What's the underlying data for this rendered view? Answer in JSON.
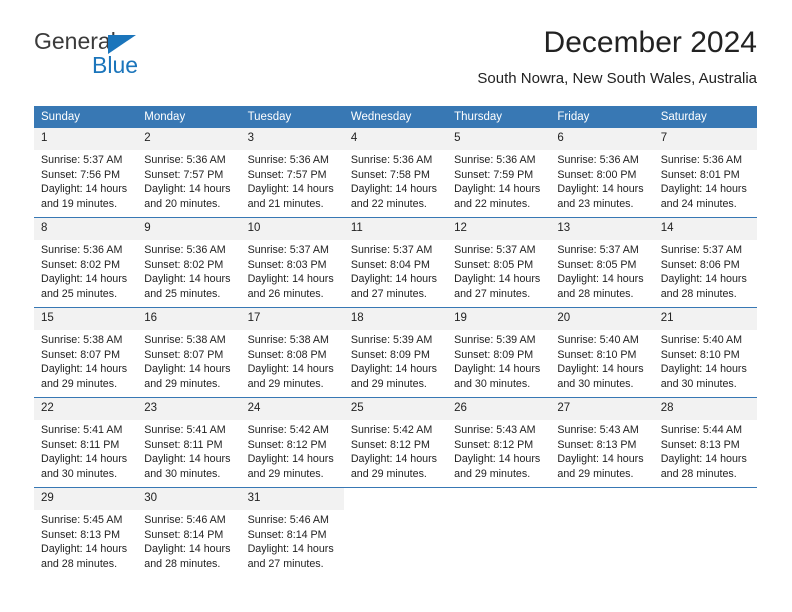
{
  "brand": {
    "name_top": "General",
    "name_bottom": "Blue",
    "triangle_color": "#1b75bb",
    "text_color": "#3b3b3b"
  },
  "header": {
    "title": "December 2024",
    "subtitle": "South Nowra, New South Wales, Australia"
  },
  "theme": {
    "header_blue": "#3878b4",
    "daynum_bg": "#f2f2f2",
    "text": "#222222"
  },
  "calendar": {
    "weekday_headers": [
      "Sunday",
      "Monday",
      "Tuesday",
      "Wednesday",
      "Thursday",
      "Friday",
      "Saturday"
    ],
    "labels": {
      "sunrise": "Sunrise:",
      "sunset": "Sunset:",
      "daylight": "Daylight:"
    },
    "weeks": [
      [
        {
          "day": "1",
          "sunrise": "Sunrise: 5:37 AM",
          "sunset": "Sunset: 7:56 PM",
          "daylight_line1": "Daylight: 14 hours",
          "daylight_line2": "and 19 minutes."
        },
        {
          "day": "2",
          "sunrise": "Sunrise: 5:36 AM",
          "sunset": "Sunset: 7:57 PM",
          "daylight_line1": "Daylight: 14 hours",
          "daylight_line2": "and 20 minutes."
        },
        {
          "day": "3",
          "sunrise": "Sunrise: 5:36 AM",
          "sunset": "Sunset: 7:57 PM",
          "daylight_line1": "Daylight: 14 hours",
          "daylight_line2": "and 21 minutes."
        },
        {
          "day": "4",
          "sunrise": "Sunrise: 5:36 AM",
          "sunset": "Sunset: 7:58 PM",
          "daylight_line1": "Daylight: 14 hours",
          "daylight_line2": "and 22 minutes."
        },
        {
          "day": "5",
          "sunrise": "Sunrise: 5:36 AM",
          "sunset": "Sunset: 7:59 PM",
          "daylight_line1": "Daylight: 14 hours",
          "daylight_line2": "and 22 minutes."
        },
        {
          "day": "6",
          "sunrise": "Sunrise: 5:36 AM",
          "sunset": "Sunset: 8:00 PM",
          "daylight_line1": "Daylight: 14 hours",
          "daylight_line2": "and 23 minutes."
        },
        {
          "day": "7",
          "sunrise": "Sunrise: 5:36 AM",
          "sunset": "Sunset: 8:01 PM",
          "daylight_line1": "Daylight: 14 hours",
          "daylight_line2": "and 24 minutes."
        }
      ],
      [
        {
          "day": "8",
          "sunrise": "Sunrise: 5:36 AM",
          "sunset": "Sunset: 8:02 PM",
          "daylight_line1": "Daylight: 14 hours",
          "daylight_line2": "and 25 minutes."
        },
        {
          "day": "9",
          "sunrise": "Sunrise: 5:36 AM",
          "sunset": "Sunset: 8:02 PM",
          "daylight_line1": "Daylight: 14 hours",
          "daylight_line2": "and 25 minutes."
        },
        {
          "day": "10",
          "sunrise": "Sunrise: 5:37 AM",
          "sunset": "Sunset: 8:03 PM",
          "daylight_line1": "Daylight: 14 hours",
          "daylight_line2": "and 26 minutes."
        },
        {
          "day": "11",
          "sunrise": "Sunrise: 5:37 AM",
          "sunset": "Sunset: 8:04 PM",
          "daylight_line1": "Daylight: 14 hours",
          "daylight_line2": "and 27 minutes."
        },
        {
          "day": "12",
          "sunrise": "Sunrise: 5:37 AM",
          "sunset": "Sunset: 8:05 PM",
          "daylight_line1": "Daylight: 14 hours",
          "daylight_line2": "and 27 minutes."
        },
        {
          "day": "13",
          "sunrise": "Sunrise: 5:37 AM",
          "sunset": "Sunset: 8:05 PM",
          "daylight_line1": "Daylight: 14 hours",
          "daylight_line2": "and 28 minutes."
        },
        {
          "day": "14",
          "sunrise": "Sunrise: 5:37 AM",
          "sunset": "Sunset: 8:06 PM",
          "daylight_line1": "Daylight: 14 hours",
          "daylight_line2": "and 28 minutes."
        }
      ],
      [
        {
          "day": "15",
          "sunrise": "Sunrise: 5:38 AM",
          "sunset": "Sunset: 8:07 PM",
          "daylight_line1": "Daylight: 14 hours",
          "daylight_line2": "and 29 minutes."
        },
        {
          "day": "16",
          "sunrise": "Sunrise: 5:38 AM",
          "sunset": "Sunset: 8:07 PM",
          "daylight_line1": "Daylight: 14 hours",
          "daylight_line2": "and 29 minutes."
        },
        {
          "day": "17",
          "sunrise": "Sunrise: 5:38 AM",
          "sunset": "Sunset: 8:08 PM",
          "daylight_line1": "Daylight: 14 hours",
          "daylight_line2": "and 29 minutes."
        },
        {
          "day": "18",
          "sunrise": "Sunrise: 5:39 AM",
          "sunset": "Sunset: 8:09 PM",
          "daylight_line1": "Daylight: 14 hours",
          "daylight_line2": "and 29 minutes."
        },
        {
          "day": "19",
          "sunrise": "Sunrise: 5:39 AM",
          "sunset": "Sunset: 8:09 PM",
          "daylight_line1": "Daylight: 14 hours",
          "daylight_line2": "and 30 minutes."
        },
        {
          "day": "20",
          "sunrise": "Sunrise: 5:40 AM",
          "sunset": "Sunset: 8:10 PM",
          "daylight_line1": "Daylight: 14 hours",
          "daylight_line2": "and 30 minutes."
        },
        {
          "day": "21",
          "sunrise": "Sunrise: 5:40 AM",
          "sunset": "Sunset: 8:10 PM",
          "daylight_line1": "Daylight: 14 hours",
          "daylight_line2": "and 30 minutes."
        }
      ],
      [
        {
          "day": "22",
          "sunrise": "Sunrise: 5:41 AM",
          "sunset": "Sunset: 8:11 PM",
          "daylight_line1": "Daylight: 14 hours",
          "daylight_line2": "and 30 minutes."
        },
        {
          "day": "23",
          "sunrise": "Sunrise: 5:41 AM",
          "sunset": "Sunset: 8:11 PM",
          "daylight_line1": "Daylight: 14 hours",
          "daylight_line2": "and 30 minutes."
        },
        {
          "day": "24",
          "sunrise": "Sunrise: 5:42 AM",
          "sunset": "Sunset: 8:12 PM",
          "daylight_line1": "Daylight: 14 hours",
          "daylight_line2": "and 29 minutes."
        },
        {
          "day": "25",
          "sunrise": "Sunrise: 5:42 AM",
          "sunset": "Sunset: 8:12 PM",
          "daylight_line1": "Daylight: 14 hours",
          "daylight_line2": "and 29 minutes."
        },
        {
          "day": "26",
          "sunrise": "Sunrise: 5:43 AM",
          "sunset": "Sunset: 8:12 PM",
          "daylight_line1": "Daylight: 14 hours",
          "daylight_line2": "and 29 minutes."
        },
        {
          "day": "27",
          "sunrise": "Sunrise: 5:43 AM",
          "sunset": "Sunset: 8:13 PM",
          "daylight_line1": "Daylight: 14 hours",
          "daylight_line2": "and 29 minutes."
        },
        {
          "day": "28",
          "sunrise": "Sunrise: 5:44 AM",
          "sunset": "Sunset: 8:13 PM",
          "daylight_line1": "Daylight: 14 hours",
          "daylight_line2": "and 28 minutes."
        }
      ],
      [
        {
          "day": "29",
          "sunrise": "Sunrise: 5:45 AM",
          "sunset": "Sunset: 8:13 PM",
          "daylight_line1": "Daylight: 14 hours",
          "daylight_line2": "and 28 minutes."
        },
        {
          "day": "30",
          "sunrise": "Sunrise: 5:46 AM",
          "sunset": "Sunset: 8:14 PM",
          "daylight_line1": "Daylight: 14 hours",
          "daylight_line2": "and 28 minutes."
        },
        {
          "day": "31",
          "sunrise": "Sunrise: 5:46 AM",
          "sunset": "Sunset: 8:14 PM",
          "daylight_line1": "Daylight: 14 hours",
          "daylight_line2": "and 27 minutes."
        },
        null,
        null,
        null,
        null
      ]
    ]
  }
}
